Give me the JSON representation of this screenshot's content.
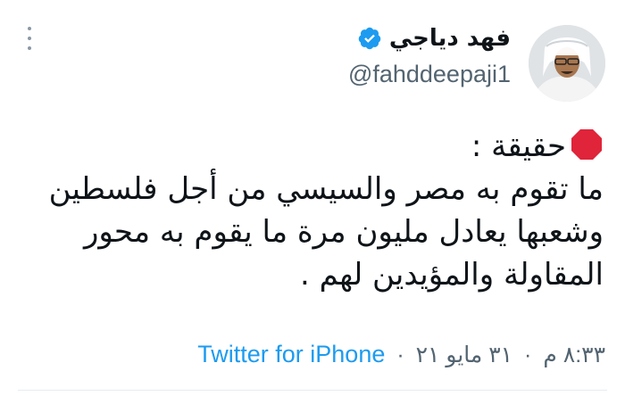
{
  "user": {
    "display_name": "فهد دياجي",
    "handle": "@fahddeepaji1",
    "verified": true
  },
  "tweet": {
    "lines": [
      "حقيقة :",
      "ما تقوم به مصر والسيسي من أجل فلسطين",
      "وشعبها يعادل مليون مرة ما يقوم به محور",
      "المقاولة والمؤيدين لهم ."
    ],
    "leading_emoji": "stop-sign-icon"
  },
  "meta": {
    "time": "٨:٣٣ م",
    "date": "٣١ مايو ٢١",
    "separator": "·",
    "source": "Twitter for iPhone"
  },
  "colors": {
    "verified_badge": "#1d9bf0",
    "link": "#1d9bf0",
    "stop_sign": "#e0243a",
    "secondary_text": "#536471"
  }
}
